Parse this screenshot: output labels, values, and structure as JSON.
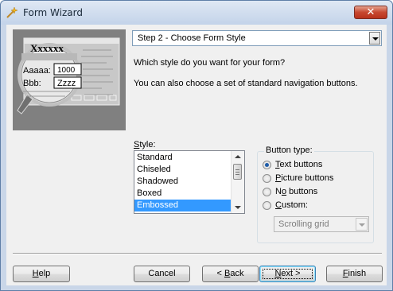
{
  "window": {
    "title": "Form Wizard"
  },
  "step_selector": {
    "value": "Step 2 - Choose Form Style"
  },
  "description": {
    "line1": "Which style do you want for your form?",
    "line2": "You can also choose a set of standard navigation buttons."
  },
  "preview": {
    "title": "Xxxxxx",
    "field1_label": "Aaaaa:",
    "field1_value": "1000",
    "field2_label": "Bbb:",
    "field2_value": "Zzzz"
  },
  "style": {
    "label_mnemonic": "S",
    "label_rest": "tyle:",
    "items": [
      "Standard",
      "Chiseled",
      "Shadowed",
      "Boxed",
      "Embossed"
    ],
    "selected": "Embossed"
  },
  "button_type": {
    "label": "Button type:",
    "options": [
      {
        "mnemonic": "T",
        "rest": "ext buttons",
        "selected": true
      },
      {
        "mnemonic": "P",
        "rest": "icture buttons",
        "selected": false
      },
      {
        "pre": "N",
        "mnemonic": "o",
        "rest": " buttons",
        "selected": false
      },
      {
        "mnemonic": "C",
        "rest": "ustom:",
        "selected": false
      }
    ],
    "custom_value": "Scrolling grid"
  },
  "buttons": {
    "help": {
      "mnemonic": "H",
      "rest": "elp"
    },
    "cancel": {
      "label": "Cancel"
    },
    "back": {
      "prefix": "< ",
      "mnemonic": "B",
      "rest": "ack"
    },
    "next": {
      "mnemonic": "N",
      "rest": "ext >"
    },
    "finish": {
      "mnemonic": "F",
      "rest": "inish"
    }
  },
  "colors": {
    "selection": "#3399ff",
    "close_button": "#c7472f",
    "preview_bg": "#808080"
  }
}
